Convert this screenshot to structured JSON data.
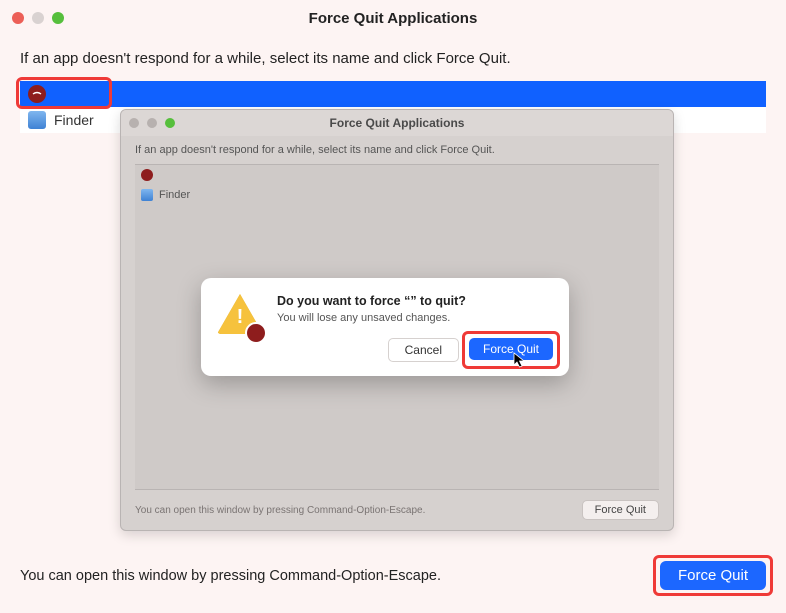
{
  "outer": {
    "title": "Force Quit Applications",
    "instruction": "If an app doesn't respond for a while, select its name and click Force Quit.",
    "apps": [
      {
        "label": "",
        "icon": "app-red"
      },
      {
        "label": "Finder",
        "icon": "finder"
      }
    ],
    "hint": "You can open this window by pressing Command-Option-Escape.",
    "force_quit_label": "Force Quit"
  },
  "inner": {
    "title": "Force Quit Applications",
    "instruction": "If an app doesn't respond for a while, select its name and click Force Quit.",
    "apps": [
      {
        "label": "",
        "icon": "app-red"
      },
      {
        "label": "Finder",
        "icon": "finder"
      }
    ],
    "hint": "You can open this window by pressing Command-Option-Escape.",
    "force_quit_label": "Force Quit"
  },
  "dialog": {
    "title": "Do you want to force “” to quit?",
    "subtitle": "You will lose any unsaved changes.",
    "cancel_label": "Cancel",
    "confirm_label": "Force Quit"
  }
}
